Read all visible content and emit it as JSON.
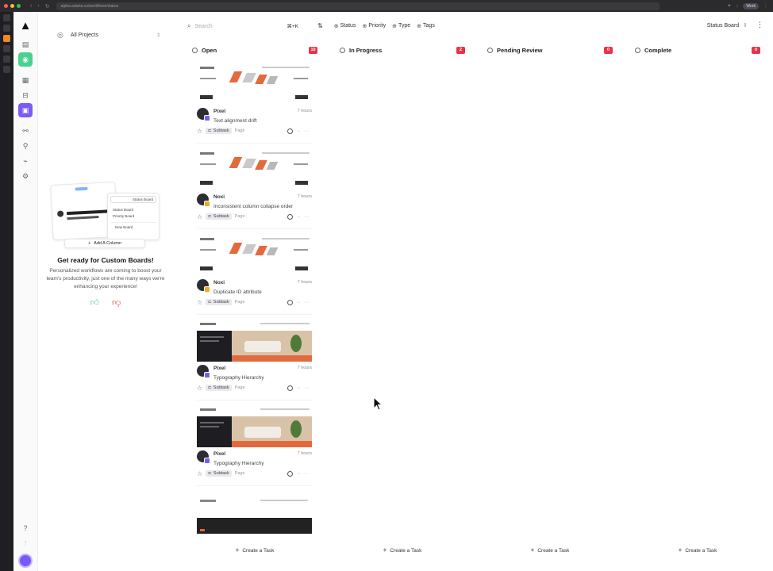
{
  "browser": {
    "url": "alpha.adarta.co/workflows/status",
    "profile": "Work"
  },
  "colors": {
    "accent": "#7a5af8",
    "success": "#48d18f",
    "count_badge": "#e8334a"
  },
  "project": {
    "label": "All Projects"
  },
  "promo": {
    "title": "Get ready for Custom Boards!",
    "text": "Personalized workflows are coming to boost your team's productivity, just one of the many ways we're enhancing your experience!",
    "card_menu": [
      "Status Board",
      "Status Board",
      "Priority Board",
      "New Board"
    ],
    "add_column": "Add A Column"
  },
  "toolbar": {
    "search_placeholder": "Search",
    "search_shortcut": "⌘+K",
    "filters": [
      "Status",
      "Priority",
      "Type",
      "Tags"
    ],
    "view": "Status Board"
  },
  "columns": [
    {
      "label": "Open",
      "count": "10",
      "create": "Create a Task"
    },
    {
      "label": "In Progress",
      "count": "2",
      "create": "Create a Task"
    },
    {
      "label": "Pending Review",
      "count": "0",
      "create": "Create a Task"
    },
    {
      "label": "Complete",
      "count": "0",
      "create": "Create a Task"
    }
  ],
  "cards": [
    {
      "user": "Pixel",
      "time": "7 hours",
      "title": "Text alignment drift",
      "tag": "Subtask",
      "type": "Page",
      "thumb": "product"
    },
    {
      "user": "Noxi",
      "time": "7 hours",
      "title": "Inconsistent column collapse order",
      "tag": "Subtask",
      "type": "Page",
      "thumb": "product"
    },
    {
      "user": "Noxi",
      "time": "7 hours",
      "title": "Duplicate ID attribute",
      "tag": "Subtask",
      "type": "Page",
      "thumb": "product"
    },
    {
      "user": "Pixel",
      "time": "7 hours",
      "title": "Typography Hierarchy",
      "tag": "Subtask",
      "type": "Page",
      "thumb": "interior"
    },
    {
      "user": "Pixel",
      "time": "7 hours",
      "title": "Typography Hierarchy",
      "tag": "Subtask",
      "type": "Page",
      "thumb": "interior"
    }
  ]
}
